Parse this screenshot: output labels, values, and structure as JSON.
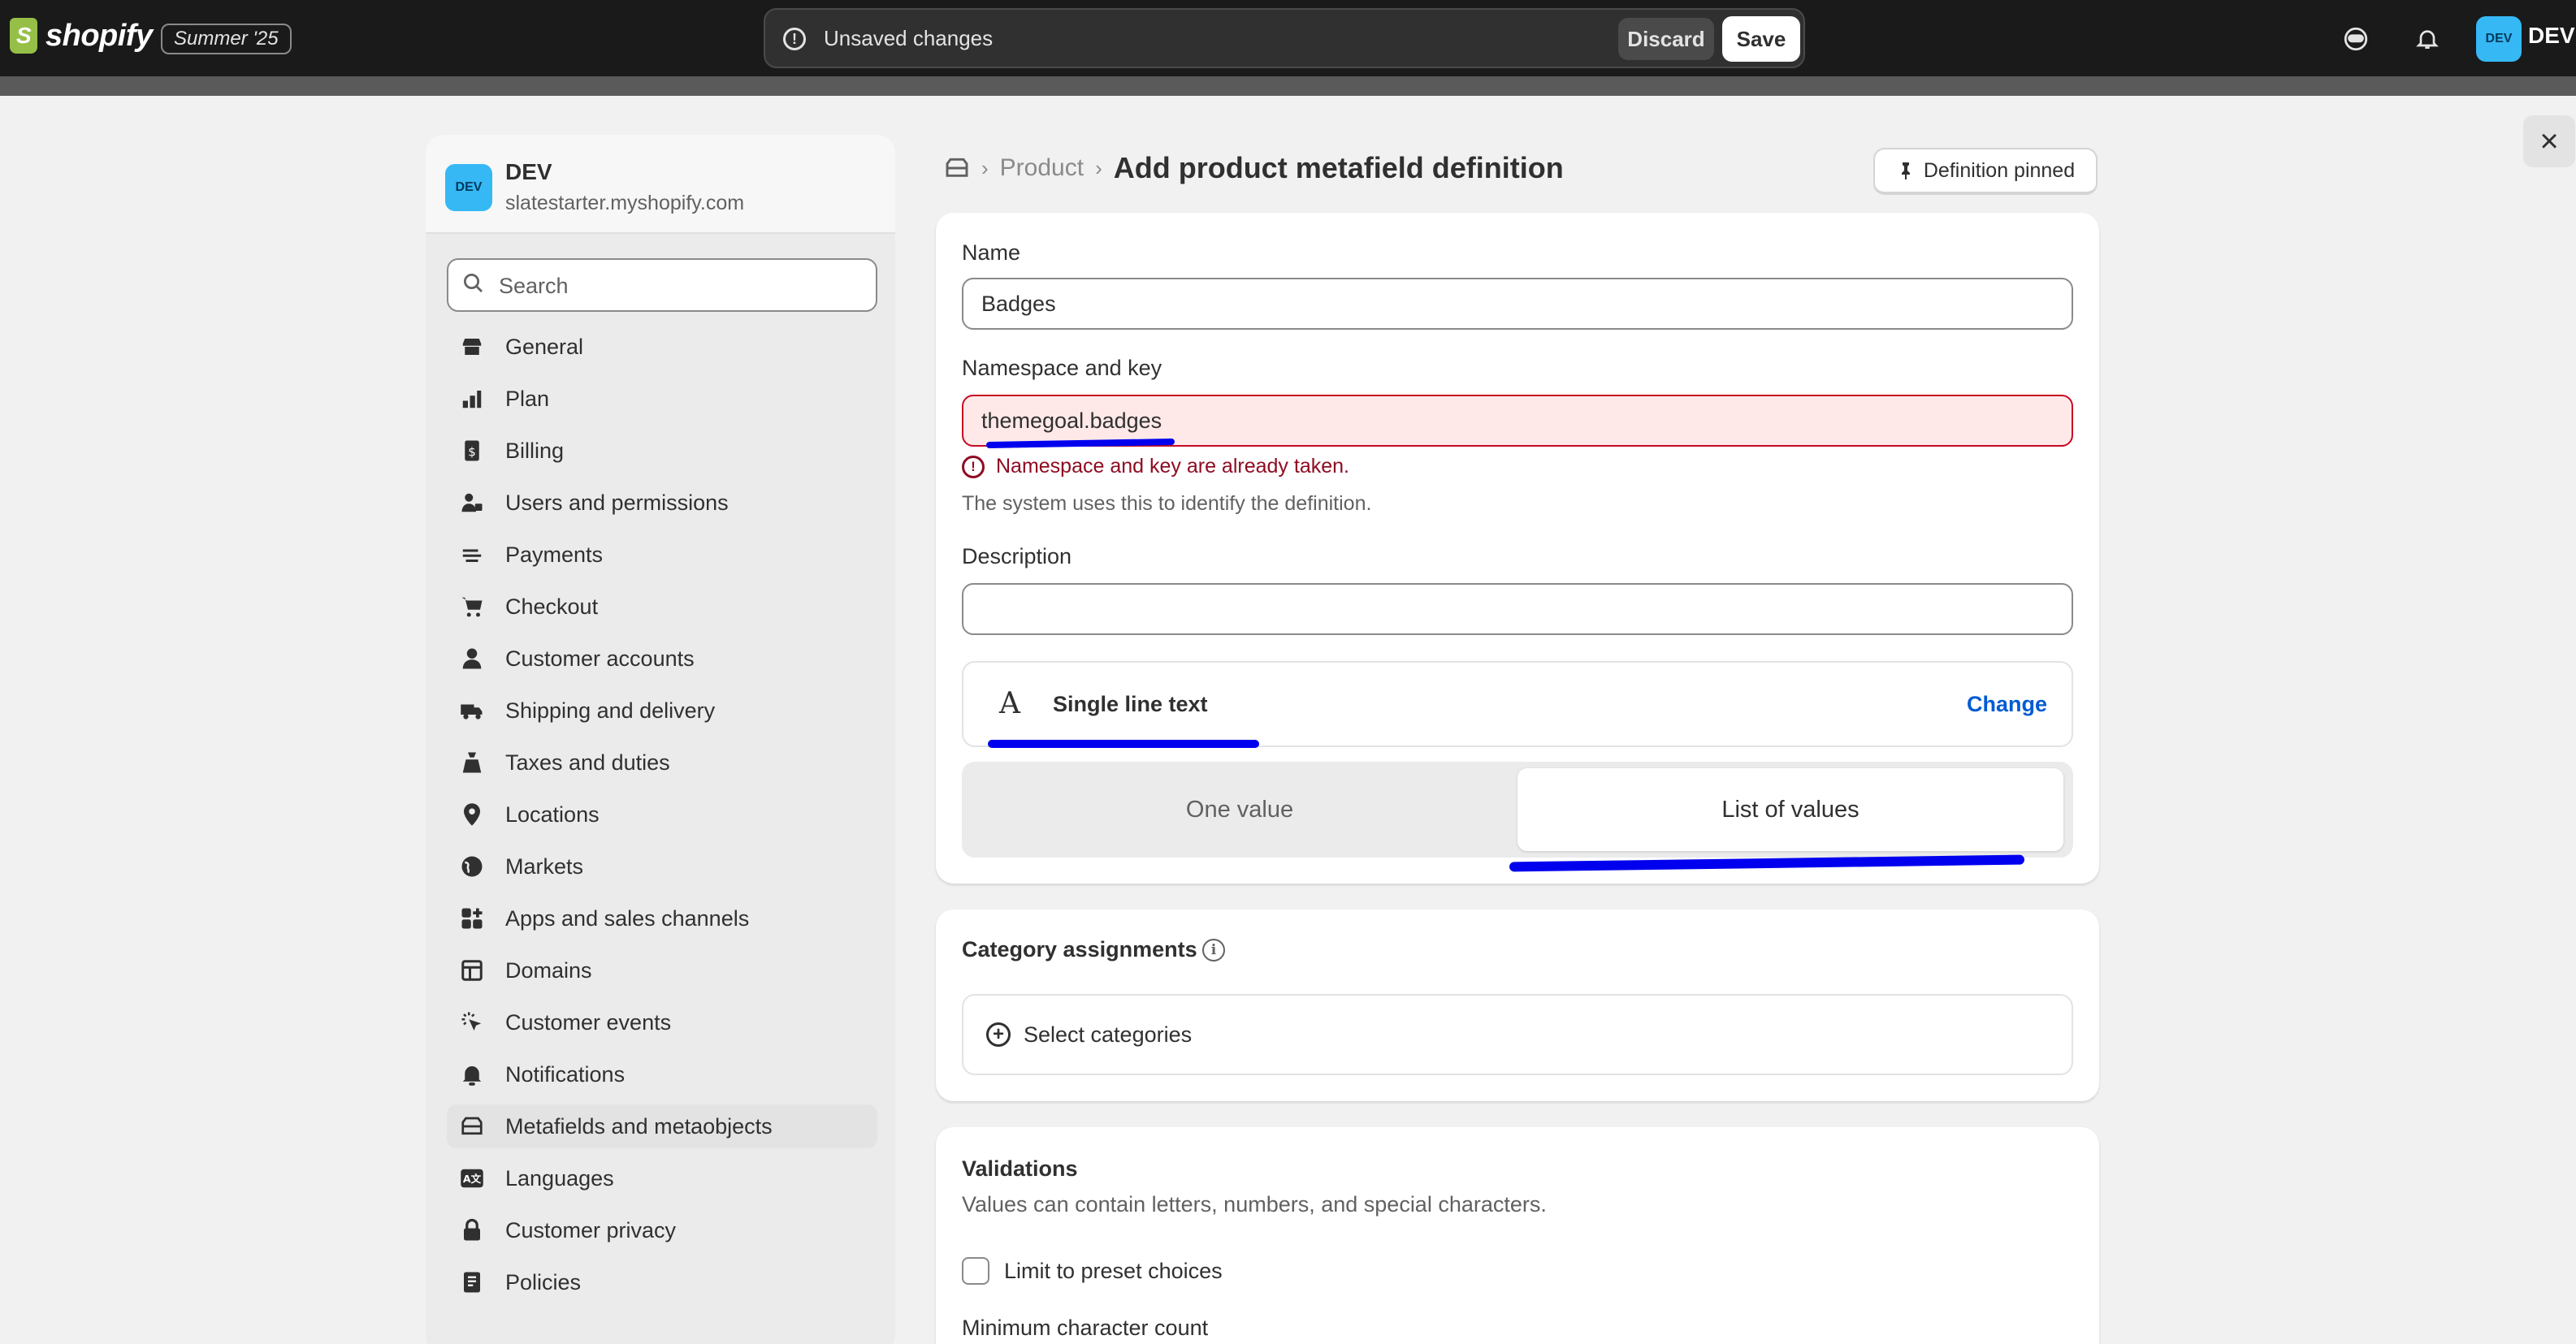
{
  "topbar": {
    "brand": "shopify",
    "edition_badge": "Summer '25",
    "unsaved_text": "Unsaved changes",
    "discard_label": "Discard",
    "save_label": "Save",
    "avatar_initials": "DEV",
    "user_name": "DEV",
    "icons": [
      "notifications-bell-icon",
      "assistant-icon"
    ]
  },
  "sidebar": {
    "store_initials": "DEV",
    "store_name": "DEV",
    "store_url": "slatestarter.myshopify.com",
    "search_placeholder": "Search",
    "items": [
      {
        "label": "General",
        "icon": "store-icon"
      },
      {
        "label": "Plan",
        "icon": "plan-icon"
      },
      {
        "label": "Billing",
        "icon": "billing-icon"
      },
      {
        "label": "Users and permissions",
        "icon": "users-icon"
      },
      {
        "label": "Payments",
        "icon": "payments-icon"
      },
      {
        "label": "Checkout",
        "icon": "cart-icon"
      },
      {
        "label": "Customer accounts",
        "icon": "person-icon"
      },
      {
        "label": "Shipping and delivery",
        "icon": "truck-icon"
      },
      {
        "label": "Taxes and duties",
        "icon": "tax-icon"
      },
      {
        "label": "Locations",
        "icon": "location-icon"
      },
      {
        "label": "Markets",
        "icon": "globe-icon"
      },
      {
        "label": "Apps and sales channels",
        "icon": "apps-icon"
      },
      {
        "label": "Domains",
        "icon": "domains-icon"
      },
      {
        "label": "Customer events",
        "icon": "cursor-icon"
      },
      {
        "label": "Notifications",
        "icon": "bell-icon"
      },
      {
        "label": "Metafields and metaobjects",
        "icon": "metafields-icon",
        "active": true
      },
      {
        "label": "Languages",
        "icon": "language-icon"
      },
      {
        "label": "Customer privacy",
        "icon": "lock-icon"
      },
      {
        "label": "Policies",
        "icon": "policies-icon"
      }
    ]
  },
  "header": {
    "breadcrumb_parent": "Product",
    "title": "Add product metafield definition",
    "pin_label": "Definition pinned"
  },
  "form": {
    "name_label": "Name",
    "name_value": "Badges",
    "namespace_label": "Namespace and key",
    "namespace_value": "themegoal.badges",
    "namespace_error": "Namespace and key are already taken.",
    "namespace_help": "The system uses this to identify the definition.",
    "description_label": "Description",
    "description_value": "",
    "type_name": "Single line text",
    "type_change": "Change",
    "type_glyph": "A",
    "option_one": "One value",
    "option_list": "List of values",
    "selected_option": "List of values"
  },
  "categories": {
    "title": "Category assignments",
    "select_label": "Select categories"
  },
  "validations": {
    "title": "Validations",
    "description": "Values can contain letters, numbers, and special characters.",
    "preset_label": "Limit to preset choices",
    "preset_checked": false,
    "min_count_label": "Minimum character count"
  },
  "colors": {
    "topbar_bg": "#1a1a1a",
    "accent_link": "#005bd3",
    "error": "#8e0b21",
    "error_bg": "#fee9e8",
    "annotation": "#0000ee"
  }
}
